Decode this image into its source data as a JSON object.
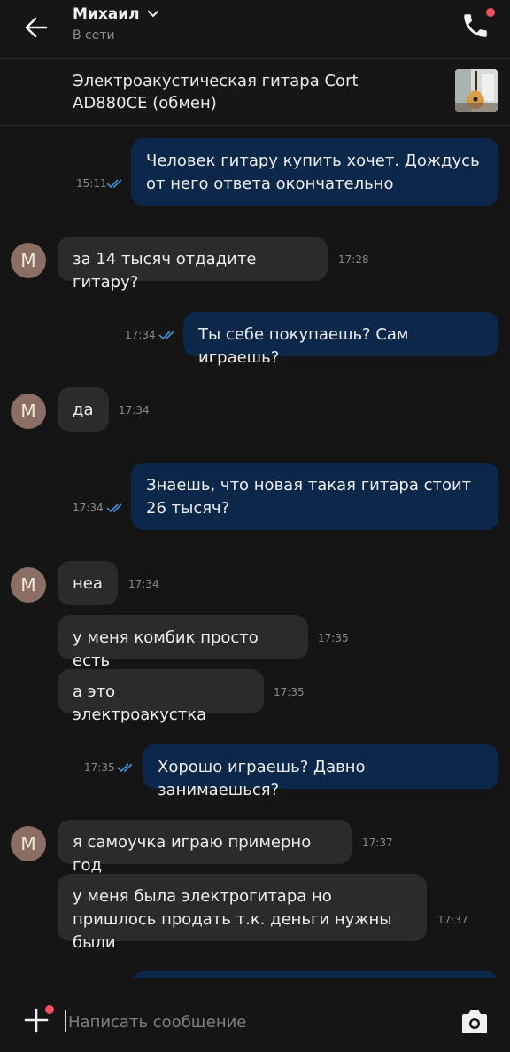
{
  "header": {
    "contact_name": "Михаил",
    "status": "В сети",
    "back_icon": "arrow-left-icon",
    "call_icon": "phone-icon"
  },
  "listing": {
    "title": "Электроакустическая гитара Cort AD880CE (обмен)"
  },
  "messages": [
    {
      "direction": "out",
      "text": "Человек гитару купить хочет. Дождусь от него ответа окончательно",
      "time": "15:11",
      "read": true
    },
    {
      "direction": "in",
      "text": "за 14 тысяч отдадите гитару?",
      "time": "17:28",
      "avatar": "M"
    },
    {
      "direction": "out",
      "text": "Ты себе покупаешь? Сам играешь?",
      "time": "17:34",
      "read": true
    },
    {
      "direction": "in",
      "text": "да",
      "time": "17:34",
      "avatar": "M"
    },
    {
      "direction": "out",
      "text": "Знаешь, что новая такая гитара стоит 26 тысяч?",
      "time": "17:34",
      "read": true
    },
    {
      "direction": "in",
      "text": "неа",
      "time": "17:34",
      "avatar": "M"
    },
    {
      "direction": "in",
      "text": "у меня комбик просто есть",
      "time": "17:35"
    },
    {
      "direction": "in",
      "text": "а это электроакустка",
      "time": "17:35"
    },
    {
      "direction": "out",
      "text": "Хорошо играешь? Давно занимаешься?",
      "time": "17:35",
      "read": true
    },
    {
      "direction": "in",
      "text": "я самоучка играю примерно год",
      "time": "17:37",
      "avatar": "M"
    },
    {
      "direction": "in",
      "text": "у меня была электрогитара но пришлось продать т.к. деньги нужны были",
      "time": "17:37"
    }
  ],
  "composer": {
    "placeholder": "Написать сообщение",
    "add_icon": "plus-icon",
    "camera_icon": "camera-icon"
  },
  "colors": {
    "background": "#151515",
    "incoming_bubble": "#2b2b2b",
    "outgoing_bubble": "#0b2749",
    "read_ticks": "#4a90d9",
    "notification_dot": "#f0505a",
    "avatar": "#8b6e64"
  }
}
